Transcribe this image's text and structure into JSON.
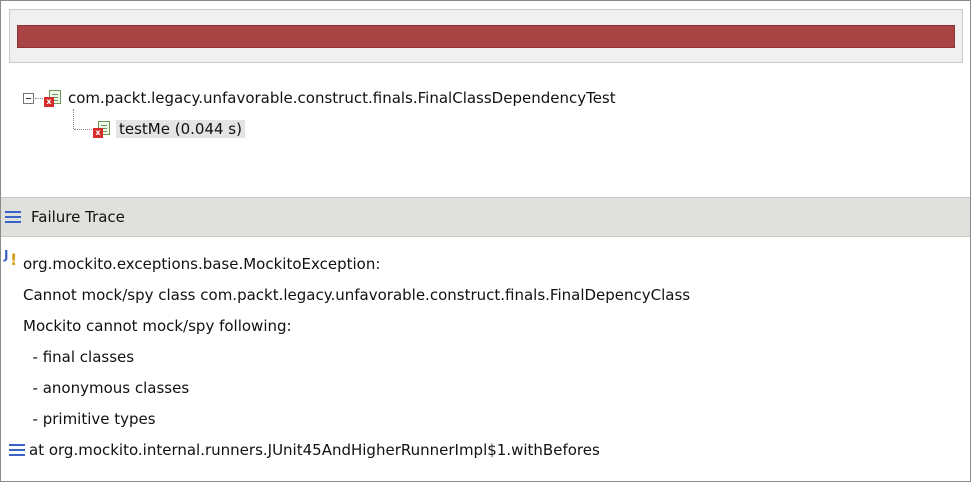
{
  "progress": {
    "status": "failed",
    "fill_fraction": 1.0,
    "color": "#a94444"
  },
  "tree": {
    "suite": {
      "label": "com.packt.legacy.unfavorable.construct.finals.FinalClassDependencyTest"
    },
    "case": {
      "label": "testMe (0.044 s)"
    }
  },
  "trace": {
    "header": "Failure Trace",
    "lines": [
      "org.mockito.exceptions.base.MockitoException:",
      "Cannot mock/spy class com.packt.legacy.unfavorable.construct.finals.FinalDepencyClass",
      "Mockito cannot mock/spy following:",
      "  - final classes",
      "  - anonymous classes",
      "  - primitive types",
      "at org.mockito.internal.runners.JUnit45AndHigherRunnerImpl$1.withBefores"
    ]
  },
  "icons": {
    "expander": "collapse-icon",
    "suite": "test-suite-error-icon",
    "case": "test-case-error-icon",
    "trace_header": "hamburger-menu-icon",
    "exception": "exception-icon",
    "stack_frame": "stack-frame-icon"
  }
}
